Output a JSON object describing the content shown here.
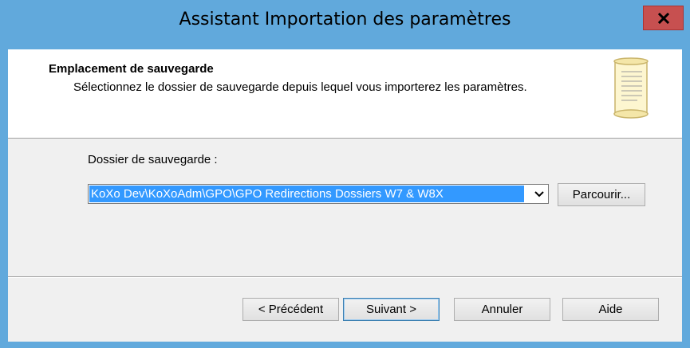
{
  "window": {
    "title": "Assistant Importation des paramètres"
  },
  "header": {
    "title": "Emplacement de sauvegarde",
    "description": "Sélectionnez le dossier de sauvegarde depuis lequel vous importerez les paramètres."
  },
  "form": {
    "folder_label": "Dossier de sauvegarde :",
    "folder_value": "KoXo Dev\\KoXoAdm\\GPO\\GPO Redirections Dossiers W7 & W8X",
    "browse_label": "Parcourir..."
  },
  "footer": {
    "previous_label": "< Précédent",
    "next_label": "Suivant >",
    "cancel_label": "Annuler",
    "help_label": "Aide"
  },
  "icons": {
    "close": "close-icon",
    "scroll": "scroll-icon",
    "dropdown": "chevron-down-icon"
  },
  "colors": {
    "frame": "#61a9dc",
    "close_button": "#c75050",
    "selection": "#3399ff"
  }
}
